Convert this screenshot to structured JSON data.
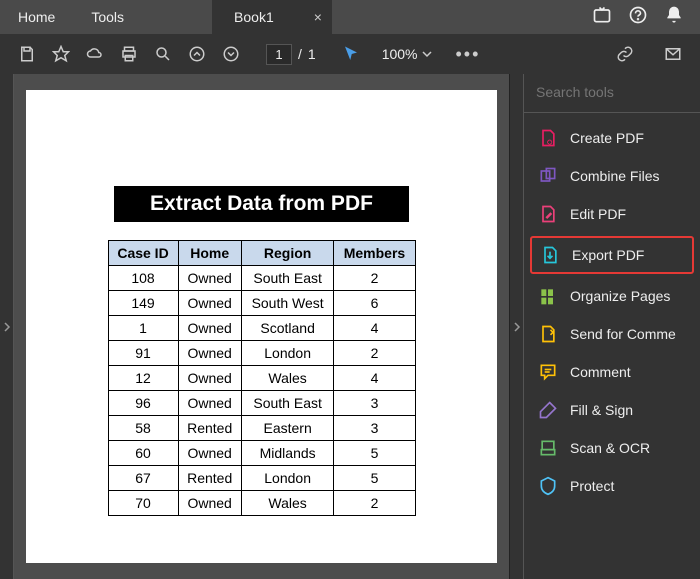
{
  "tabs": {
    "home": "Home",
    "tools": "Tools",
    "doc": "Book1",
    "close": "×"
  },
  "toolbar": {
    "page_current": "1",
    "page_sep": "/",
    "page_total": "1",
    "zoom": "100%"
  },
  "document": {
    "title": "Extract Data from PDF",
    "headers": [
      "Case ID",
      "Home",
      "Region",
      "Members"
    ],
    "rows": [
      [
        "108",
        "Owned",
        "South East",
        "2"
      ],
      [
        "149",
        "Owned",
        "South West",
        "6"
      ],
      [
        "1",
        "Owned",
        "Scotland",
        "4"
      ],
      [
        "91",
        "Owned",
        "London",
        "2"
      ],
      [
        "12",
        "Owned",
        "Wales",
        "4"
      ],
      [
        "96",
        "Owned",
        "South East",
        "3"
      ],
      [
        "58",
        "Rented",
        "Eastern",
        "3"
      ],
      [
        "60",
        "Owned",
        "Midlands",
        "5"
      ],
      [
        "67",
        "Rented",
        "London",
        "5"
      ],
      [
        "70",
        "Owned",
        "Wales",
        "2"
      ]
    ]
  },
  "right_panel": {
    "search_placeholder": "Search tools",
    "items": [
      {
        "label": "Create PDF",
        "color": "#e91e63",
        "highlight": false
      },
      {
        "label": "Combine Files",
        "color": "#7e57c2",
        "highlight": false
      },
      {
        "label": "Edit PDF",
        "color": "#ec407a",
        "highlight": false
      },
      {
        "label": "Export PDF",
        "color": "#26c6da",
        "highlight": true
      },
      {
        "label": "Organize Pages",
        "color": "#8bc34a",
        "highlight": false
      },
      {
        "label": "Send for Comme",
        "color": "#ffc107",
        "highlight": false
      },
      {
        "label": "Comment",
        "color": "#ffc107",
        "highlight": false
      },
      {
        "label": "Fill & Sign",
        "color": "#9575cd",
        "highlight": false
      },
      {
        "label": "Scan & OCR",
        "color": "#66bb6a",
        "highlight": false
      },
      {
        "label": "Protect",
        "color": "#4fc3f7",
        "highlight": false
      }
    ]
  }
}
